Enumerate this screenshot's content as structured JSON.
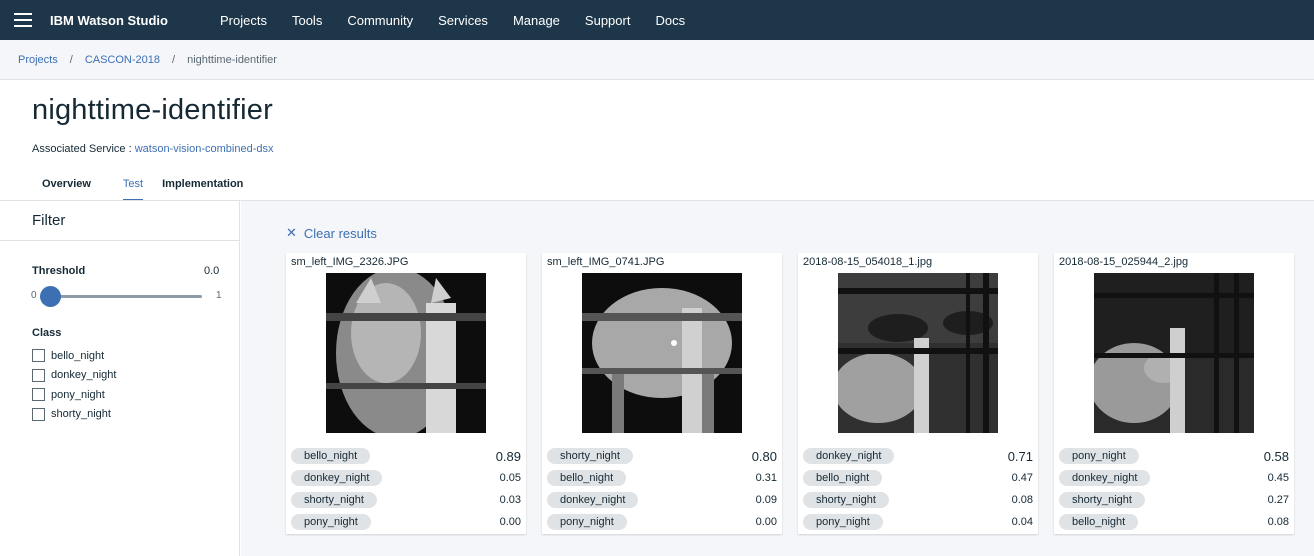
{
  "app": {
    "title": "IBM Watson Studio"
  },
  "nav": [
    "Projects",
    "Tools",
    "Community",
    "Services",
    "Manage",
    "Support",
    "Docs"
  ],
  "breadcrumb": {
    "items": [
      "Projects",
      "CASCON-2018"
    ],
    "current": "nighttime-identifier",
    "separator": "/"
  },
  "page": {
    "title": "nighttime-identifier",
    "associated_label": "Associated Service :",
    "associated_service": "watson-vision-combined-dsx"
  },
  "tabs": [
    {
      "label": "Overview",
      "active": false
    },
    {
      "label": "Test",
      "active": true
    },
    {
      "label": "Implementation",
      "active": false
    }
  ],
  "filter": {
    "title": "Filter",
    "threshold_label": "Threshold",
    "threshold_value": "0.0",
    "slider_min": "0",
    "slider_max": "1",
    "class_label": "Class",
    "classes": [
      "bello_night",
      "donkey_night",
      "pony_night",
      "shorty_night"
    ]
  },
  "results": {
    "clear_label": "Clear results",
    "clear_icon": "close-icon",
    "cards": [
      {
        "filename": "sm_left_IMG_2326.JPG",
        "scores": [
          {
            "label": "bello_night",
            "value": "0.89"
          },
          {
            "label": "donkey_night",
            "value": "0.05"
          },
          {
            "label": "shorty_night",
            "value": "0.03"
          },
          {
            "label": "pony_night",
            "value": "0.00"
          }
        ]
      },
      {
        "filename": "sm_left_IMG_0741.JPG",
        "scores": [
          {
            "label": "shorty_night",
            "value": "0.80"
          },
          {
            "label": "bello_night",
            "value": "0.31"
          },
          {
            "label": "donkey_night",
            "value": "0.09"
          },
          {
            "label": "pony_night",
            "value": "0.00"
          }
        ]
      },
      {
        "filename": "2018-08-15_054018_1.jpg",
        "scores": [
          {
            "label": "donkey_night",
            "value": "0.71"
          },
          {
            "label": "bello_night",
            "value": "0.47"
          },
          {
            "label": "shorty_night",
            "value": "0.08"
          },
          {
            "label": "pony_night",
            "value": "0.04"
          }
        ]
      },
      {
        "filename": "2018-08-15_025944_2.jpg",
        "scores": [
          {
            "label": "pony_night",
            "value": "0.58"
          },
          {
            "label": "donkey_night",
            "value": "0.45"
          },
          {
            "label": "shorty_night",
            "value": "0.27"
          },
          {
            "label": "bello_night",
            "value": "0.08"
          }
        ]
      }
    ]
  },
  "colors": {
    "topbar": "#1d3649",
    "link": "#3d70b2",
    "pill": "#dfe3e6",
    "background": "#f4f6f9"
  }
}
